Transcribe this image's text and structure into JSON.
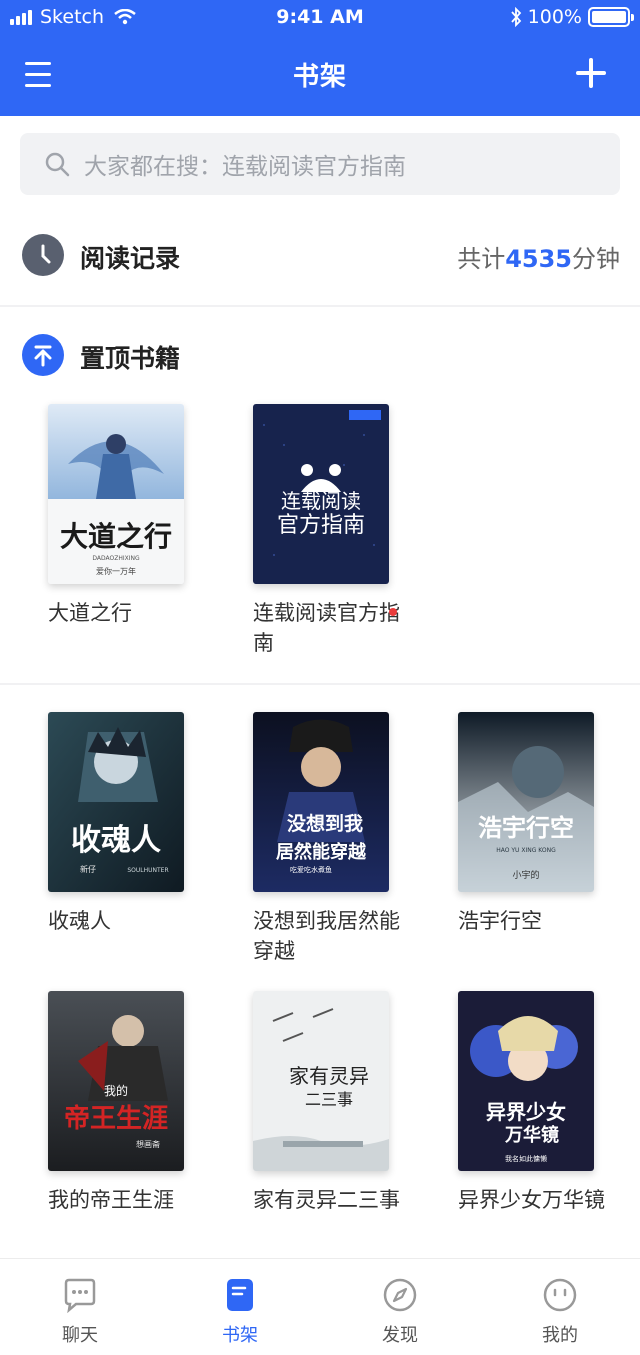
{
  "status_bar": {
    "carrier": "Sketch",
    "time": "9:41 AM",
    "battery": "100%"
  },
  "nav": {
    "title": "书架",
    "menu_icon": "menu-icon",
    "add_icon": "plus-icon"
  },
  "search": {
    "placeholder": "大家都在搜：连载阅读官方指南",
    "icon": "search-icon"
  },
  "record": {
    "label": "阅读记录",
    "total_prefix": "共计",
    "total_minutes": "4535",
    "total_suffix": "分钟",
    "icon": "clock-icon"
  },
  "pinned": {
    "label": "置顶书籍",
    "icon": "pin-top-icon",
    "books": [
      {
        "title": "大道之行",
        "cover_text": "大道之行",
        "cover_sub": "DADAOZHIXING",
        "cover_author": "爱你一万年",
        "has_update": false
      },
      {
        "title": "连载阅读官方指南",
        "cover_text": "连载阅读",
        "cover_text2": "官方指南",
        "has_update": true
      }
    ]
  },
  "shelf": {
    "books": [
      {
        "title": "收魂人",
        "cover_text": "收魂人",
        "cover_author": "新仔",
        "cover_sub": "SOULHUNTER"
      },
      {
        "title": "没想到我居然能穿越",
        "cover_text": "没想到我",
        "cover_text2": "居然能穿越",
        "cover_author": "吃爱吃水煮鱼"
      },
      {
        "title": "浩宇行空",
        "cover_text": "浩宇行空",
        "cover_sub": "HAO YU XING KONG",
        "cover_author": "小宇的"
      },
      {
        "title": "我的帝王生涯",
        "cover_text": "帝王生涯",
        "cover_text_top": "我的",
        "cover_author": "想画斋"
      },
      {
        "title": "家有灵异二三事",
        "cover_text": "家有灵异",
        "cover_text2": "二三事"
      },
      {
        "title": "异界少女万华镜",
        "cover_text": "异界少女",
        "cover_text2": "万华镜",
        "cover_author": "我名如此慵懒"
      }
    ]
  },
  "tabbar": {
    "tabs": [
      {
        "label": "聊天",
        "icon": "chat-icon",
        "active": false
      },
      {
        "label": "书架",
        "icon": "bookshelf-icon",
        "active": true
      },
      {
        "label": "发现",
        "icon": "compass-icon",
        "active": false
      },
      {
        "label": "我的",
        "icon": "smiley-icon",
        "active": false
      }
    ]
  },
  "colors": {
    "brand": "#2f67f5",
    "update_dot": "#ea3b3b"
  }
}
